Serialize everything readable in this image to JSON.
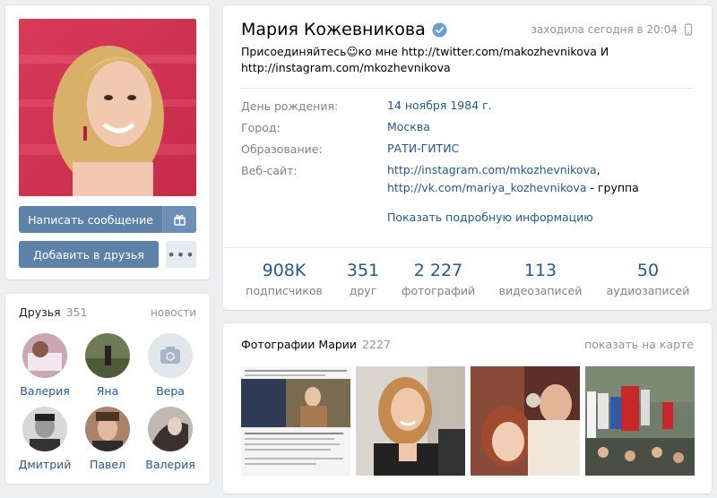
{
  "profile": {
    "name": "Мария Кожевникова",
    "last_seen": "заходила сегодня в 20:04",
    "status": "Присоединяйтесь☺ко мне http://twitter.com/makozhevnikova И http://instagram.com/mkozhevnikova",
    "actions": {
      "message": "Написать сообщение",
      "add_friend": "Добавить в друзья",
      "more": "•••"
    },
    "info": {
      "birthday_label": "День рождения:",
      "birthday": "14 ноября 1984 г.",
      "city_label": "Город:",
      "city": "Москва",
      "education_label": "Образование:",
      "education": "РАТИ-ГИТИС",
      "website_label": "Веб-сайт:",
      "website1": "http://instagram.com/mkozhevnikova",
      "website1_suffix": ",",
      "website2": "http://vk.com/mariya_kozhevnikova",
      "website2_suffix": " - группа",
      "more_link": "Показать подробную информацию"
    },
    "stats": [
      {
        "value": "908K",
        "label": "подписчиков"
      },
      {
        "value": "351",
        "label": "друг"
      },
      {
        "value": "2 227",
        "label": "фотографий"
      },
      {
        "value": "113",
        "label": "видеозаписей"
      },
      {
        "value": "50",
        "label": "аудиозаписей"
      }
    ]
  },
  "friends": {
    "title": "Друзья",
    "count": "351",
    "news_link": "новости",
    "list": [
      {
        "name": "Валерия"
      },
      {
        "name": "Яна"
      },
      {
        "name": "Вера"
      },
      {
        "name": "Дмитрий"
      },
      {
        "name": "Павел"
      },
      {
        "name": "Валерия"
      }
    ]
  },
  "photos": {
    "title": "Фотографии Марии",
    "count": "2227",
    "map_link": "показать на карте"
  },
  "colors": {
    "link": "#2a5885",
    "button": "#5e81a8",
    "background": "#edeef0"
  }
}
